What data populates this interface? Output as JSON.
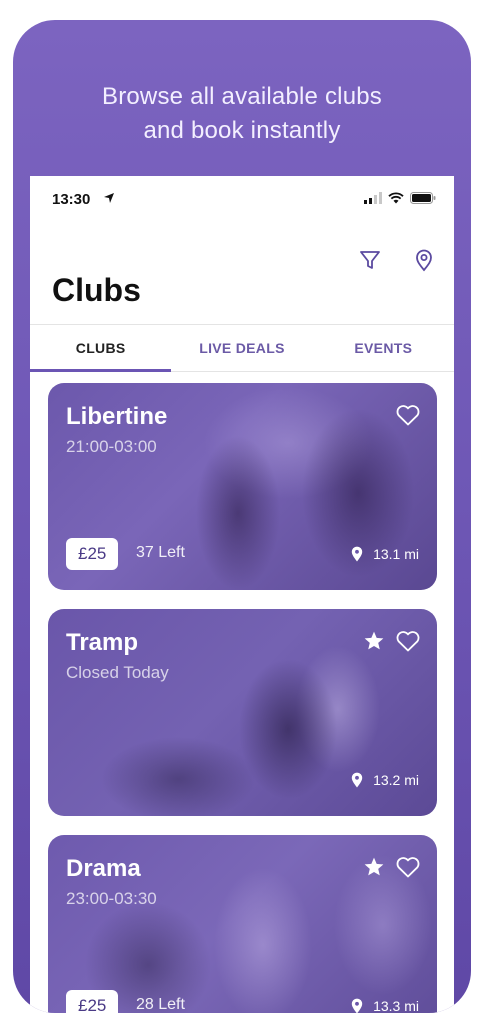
{
  "promo": {
    "headline_line1": "Browse all available clubs",
    "headline_line2": "and book instantly",
    "background_color": "#7264ba"
  },
  "status_bar": {
    "time": "13:30",
    "icons": [
      "location-arrow-icon",
      "signal-icon",
      "wifi-icon",
      "battery-icon"
    ]
  },
  "toolbar": {
    "icons": [
      "filter-icon",
      "map-pin-icon"
    ]
  },
  "page_title": "Clubs",
  "tabs": [
    {
      "label": "CLUBS",
      "active": true
    },
    {
      "label": "LIVE DEALS",
      "active": false
    },
    {
      "label": "EVENTS",
      "active": false
    }
  ],
  "clubs": [
    {
      "name": "Libertine",
      "hours": "21:00-03:00",
      "price": "£25",
      "left": "37 Left",
      "distance": "13.1 mi",
      "starred": false
    },
    {
      "name": "Tramp",
      "hours": "Closed Today",
      "price": "",
      "left": "",
      "distance": "13.2 mi",
      "starred": true
    },
    {
      "name": "Drama",
      "hours": "23:00-03:30",
      "price": "£25",
      "left": "28 Left",
      "distance": "13.3 mi",
      "starred": true
    }
  ],
  "colors": {
    "accent": "#6b55b4",
    "tab_inactive": "#6b5aa6"
  }
}
